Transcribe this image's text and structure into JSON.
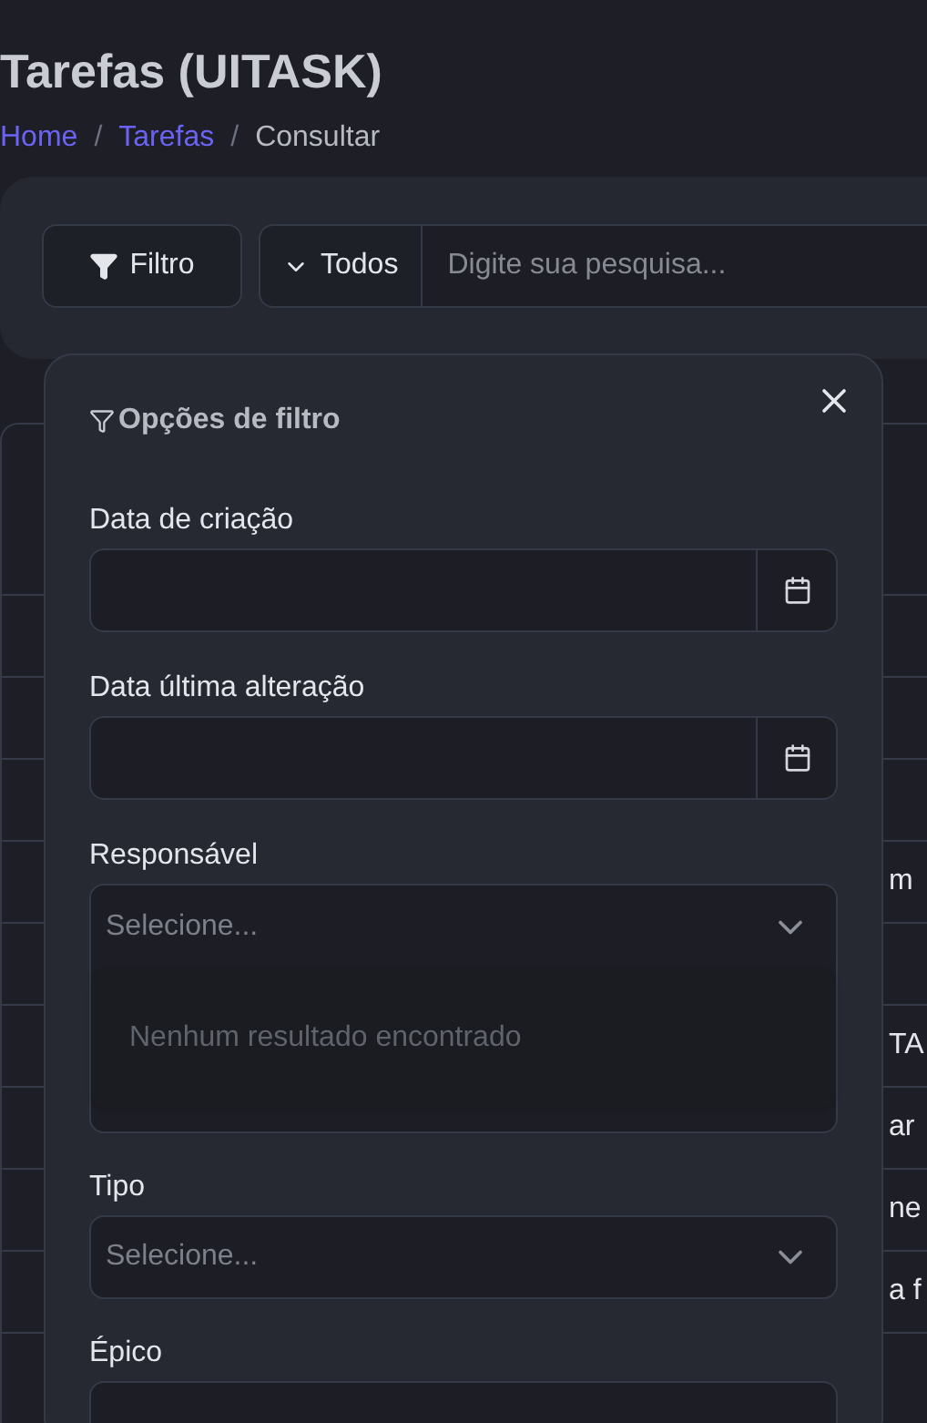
{
  "page": {
    "title": "Tarefas (UITASK)"
  },
  "breadcrumb": [
    {
      "label": "Home",
      "kind": "link"
    },
    {
      "label": "/",
      "kind": "separator"
    },
    {
      "label": "Tarefas",
      "kind": "link"
    },
    {
      "label": "/",
      "kind": "separator"
    },
    {
      "label": "Consultar",
      "kind": "current"
    }
  ],
  "toolbar": {
    "filter_button": "Filtro",
    "scope": "Todos",
    "search": {
      "placeholder": "Digite sua pesquisa..."
    }
  },
  "table": {
    "rows": [
      {
        "column_1": ""
      },
      {
        "column_1": ""
      },
      {
        "column_1": ""
      },
      {
        "column_1": "m"
      },
      {
        "column_1": ""
      },
      {
        "column_1": "TA"
      },
      {
        "column_1": "ar"
      },
      {
        "column_1": "ne"
      },
      {
        "column_1": "a f"
      }
    ]
  },
  "filter_panel": {
    "title": "Opções de filtro",
    "fields": [
      {
        "kind": "date",
        "label": "Data de criação"
      },
      {
        "kind": "date",
        "label": "Data última alteração"
      },
      {
        "kind": "select",
        "label": "Responsável",
        "placeholder": "Selecione...",
        "expanded": true,
        "empty_message": "Nenhum resultado encontrado"
      },
      {
        "kind": "select",
        "label": "Tipo",
        "placeholder": "Selecione...",
        "expanded": false
      },
      {
        "kind": "select",
        "label": "Épico",
        "expanded": false
      }
    ]
  }
}
